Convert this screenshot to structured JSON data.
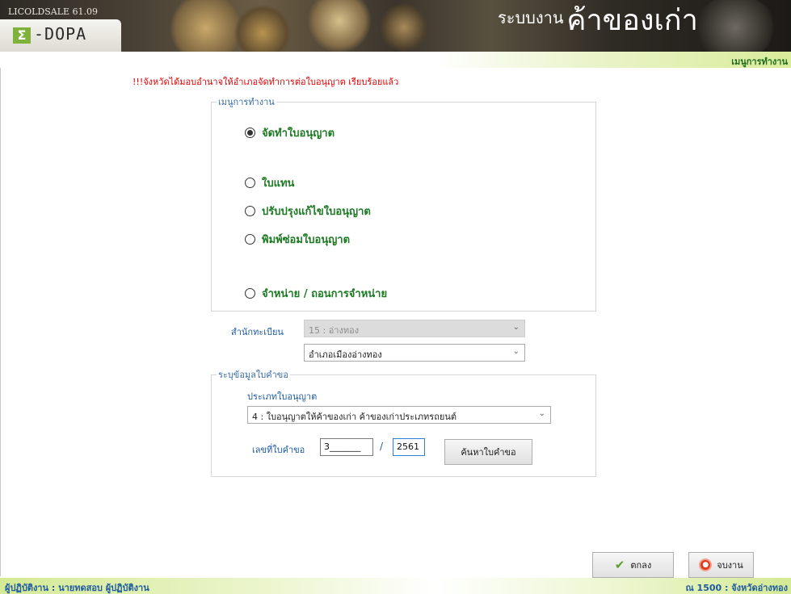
{
  "header": {
    "app_version": "LICOLDSALE 61.09",
    "logo_mark": "Σ",
    "logo_text": "-DOPA",
    "system_prefix": "ระบบงาน",
    "system_title": "ค้าของเก่า"
  },
  "menu_strip": {
    "label": "เมนูการทำงาน"
  },
  "notice": "!!!จังหวัดได้มอบอำนาจให้อำเภอจัดทำการต่อใบอนุญาต เรียบร้อยแล้ว",
  "menu_group": {
    "legend": "เมนูการทำงาน",
    "options": [
      {
        "label": "จัดทำใบอนุญาต",
        "checked": true
      },
      {
        "label": "ใบแทน",
        "checked": false
      },
      {
        "label": "ปรับปรุงแก้ไขใบอนุญาต",
        "checked": false
      },
      {
        "label": "พิมพ์ซ่อมใบอนุญาต",
        "checked": false
      },
      {
        "label": "จำหน่าย / ถอนการจำหน่าย",
        "checked": false
      }
    ]
  },
  "registry": {
    "label": "สำนักทะเบียน",
    "office_value": "15 : อ่างทอง",
    "district_value": "อำเภอเมืองอ่างทอง"
  },
  "request_group": {
    "legend": "ระบุข้อมูลใบคำขอ",
    "type_label": "ประเภทใบอนุญาต",
    "type_value": "4 : ใบอนุญาตให้ค้าของเก่า ค้าของเก่าประเภทรถยนต์",
    "request_no_label": "เลขที่ใบคำขอ",
    "request_no_value": "3_______",
    "separator": "/",
    "year_value": "2561",
    "search_button": "ค้นหาใบคำขอ"
  },
  "actions": {
    "ok_label": "ตกลง",
    "quit_label": "จบงาน"
  },
  "status_bar": {
    "user": "ผู้ปฏิบัติงาน : นายทดสอบ ผู้ปฏิบัติงาน",
    "location": "ณ 1500 : จังหวัดอ่างทอง"
  }
}
